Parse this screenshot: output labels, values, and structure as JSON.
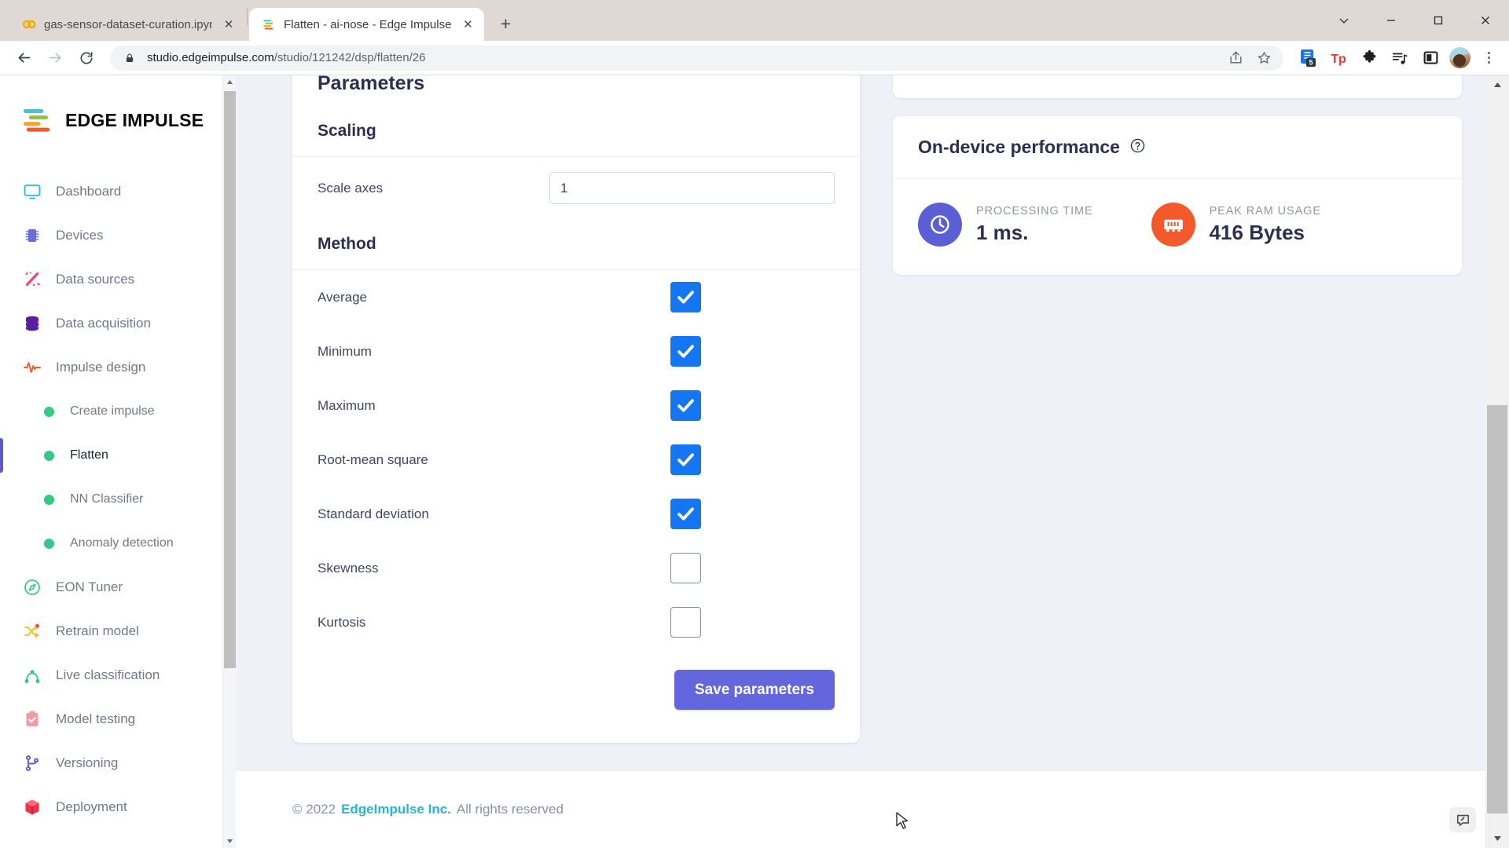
{
  "browser": {
    "tabs": [
      {
        "title": "gas-sensor-dataset-curation.ipyn",
        "favicon": "colab-icon",
        "active": false,
        "close_label": "✕"
      },
      {
        "title": "Flatten - ai-nose - Edge Impulse",
        "favicon": "edge-impulse-icon",
        "active": true,
        "close_label": "✕"
      }
    ],
    "new_tab_label": "+",
    "window_controls": [
      "chevron-down-icon",
      "minimize-icon",
      "maximize-icon",
      "close-icon"
    ],
    "nav": {
      "back": "back-arrow-icon",
      "forward": "forward-arrow-icon",
      "reload": "reload-icon"
    },
    "omnibox": {
      "lock": "lock-icon",
      "url_bold": "studio.edgeimpulse.com",
      "url_path": "/studio/121242/dsp/flatten/26",
      "share_icon": "share-icon",
      "bookmark_icon": "star-icon"
    },
    "extensions": [
      {
        "name": "notes-extension-icon",
        "badge": "5"
      },
      {
        "name": "tp-extension-icon",
        "label": "Tp"
      },
      {
        "name": "puzzle-extensions-icon"
      },
      {
        "name": "reading-list-icon"
      },
      {
        "name": "side-panel-icon"
      }
    ],
    "profile": "avatar",
    "menu": "kebab-menu-icon"
  },
  "sidebar": {
    "logo_text": "EDGE IMPULSE",
    "items": [
      {
        "label": "Dashboard",
        "icon": "monitor-icon",
        "active": false,
        "sub": false
      },
      {
        "label": "Devices",
        "icon": "chip-icon",
        "active": false,
        "sub": false
      },
      {
        "label": "Data sources",
        "icon": "magic-wand-icon",
        "active": false,
        "sub": false
      },
      {
        "label": "Data acquisition",
        "icon": "database-icon",
        "active": false,
        "sub": false
      },
      {
        "label": "Impulse design",
        "icon": "pulse-icon",
        "active": false,
        "sub": false
      },
      {
        "label": "Create impulse",
        "icon": "green-dot-icon",
        "active": false,
        "sub": true
      },
      {
        "label": "Flatten",
        "icon": "green-dot-icon",
        "active": true,
        "sub": true
      },
      {
        "label": "NN Classifier",
        "icon": "green-dot-icon",
        "active": false,
        "sub": true
      },
      {
        "label": "Anomaly detection",
        "icon": "green-dot-icon",
        "active": false,
        "sub": true
      },
      {
        "label": "EON Tuner",
        "icon": "compass-icon",
        "active": false,
        "sub": false
      },
      {
        "label": "Retrain model",
        "icon": "shuffle-icon",
        "active": false,
        "sub": false
      },
      {
        "label": "Live classification",
        "icon": "network-icon",
        "active": false,
        "sub": false
      },
      {
        "label": "Model testing",
        "icon": "clipboard-check-icon",
        "active": false,
        "sub": false
      },
      {
        "label": "Versioning",
        "icon": "git-branch-icon",
        "active": false,
        "sub": false
      },
      {
        "label": "Deployment",
        "icon": "box-icon",
        "active": false,
        "sub": false
      }
    ]
  },
  "parameters": {
    "title": "Parameters",
    "scaling_heading": "Scaling",
    "scale_axes_label": "Scale axes",
    "scale_axes_value": "1",
    "method_heading": "Method",
    "methods": [
      {
        "label": "Average",
        "checked": true
      },
      {
        "label": "Minimum",
        "checked": true
      },
      {
        "label": "Maximum",
        "checked": true
      },
      {
        "label": "Root-mean square",
        "checked": true
      },
      {
        "label": "Standard deviation",
        "checked": true
      },
      {
        "label": "Skewness",
        "checked": false
      },
      {
        "label": "Kurtosis",
        "checked": false
      }
    ],
    "save_label": "Save parameters"
  },
  "performance": {
    "title": "On-device performance",
    "help_icon": "question-circle-icon",
    "metrics": [
      {
        "label": "PROCESSING TIME",
        "value": "1 ms.",
        "icon": "clock-icon",
        "color": "#5a5fd6"
      },
      {
        "label": "PEAK RAM USAGE",
        "value": "416 Bytes",
        "icon": "ram-chip-icon",
        "color": "#f4592c"
      }
    ]
  },
  "footer": {
    "copyright": "© 2022",
    "brand": "EdgeImpulse Inc.",
    "rights": "All rights reserved"
  },
  "feedback": {
    "icon": "feedback-bubble-icon"
  },
  "colors": {
    "accent_indigo": "#6366dd",
    "checkbox_blue": "#1476f2",
    "green_dot": "#36c985",
    "brand_cyan": "#2bb5cd",
    "orange": "#f4592c",
    "page_bg": "#eef1f8"
  }
}
